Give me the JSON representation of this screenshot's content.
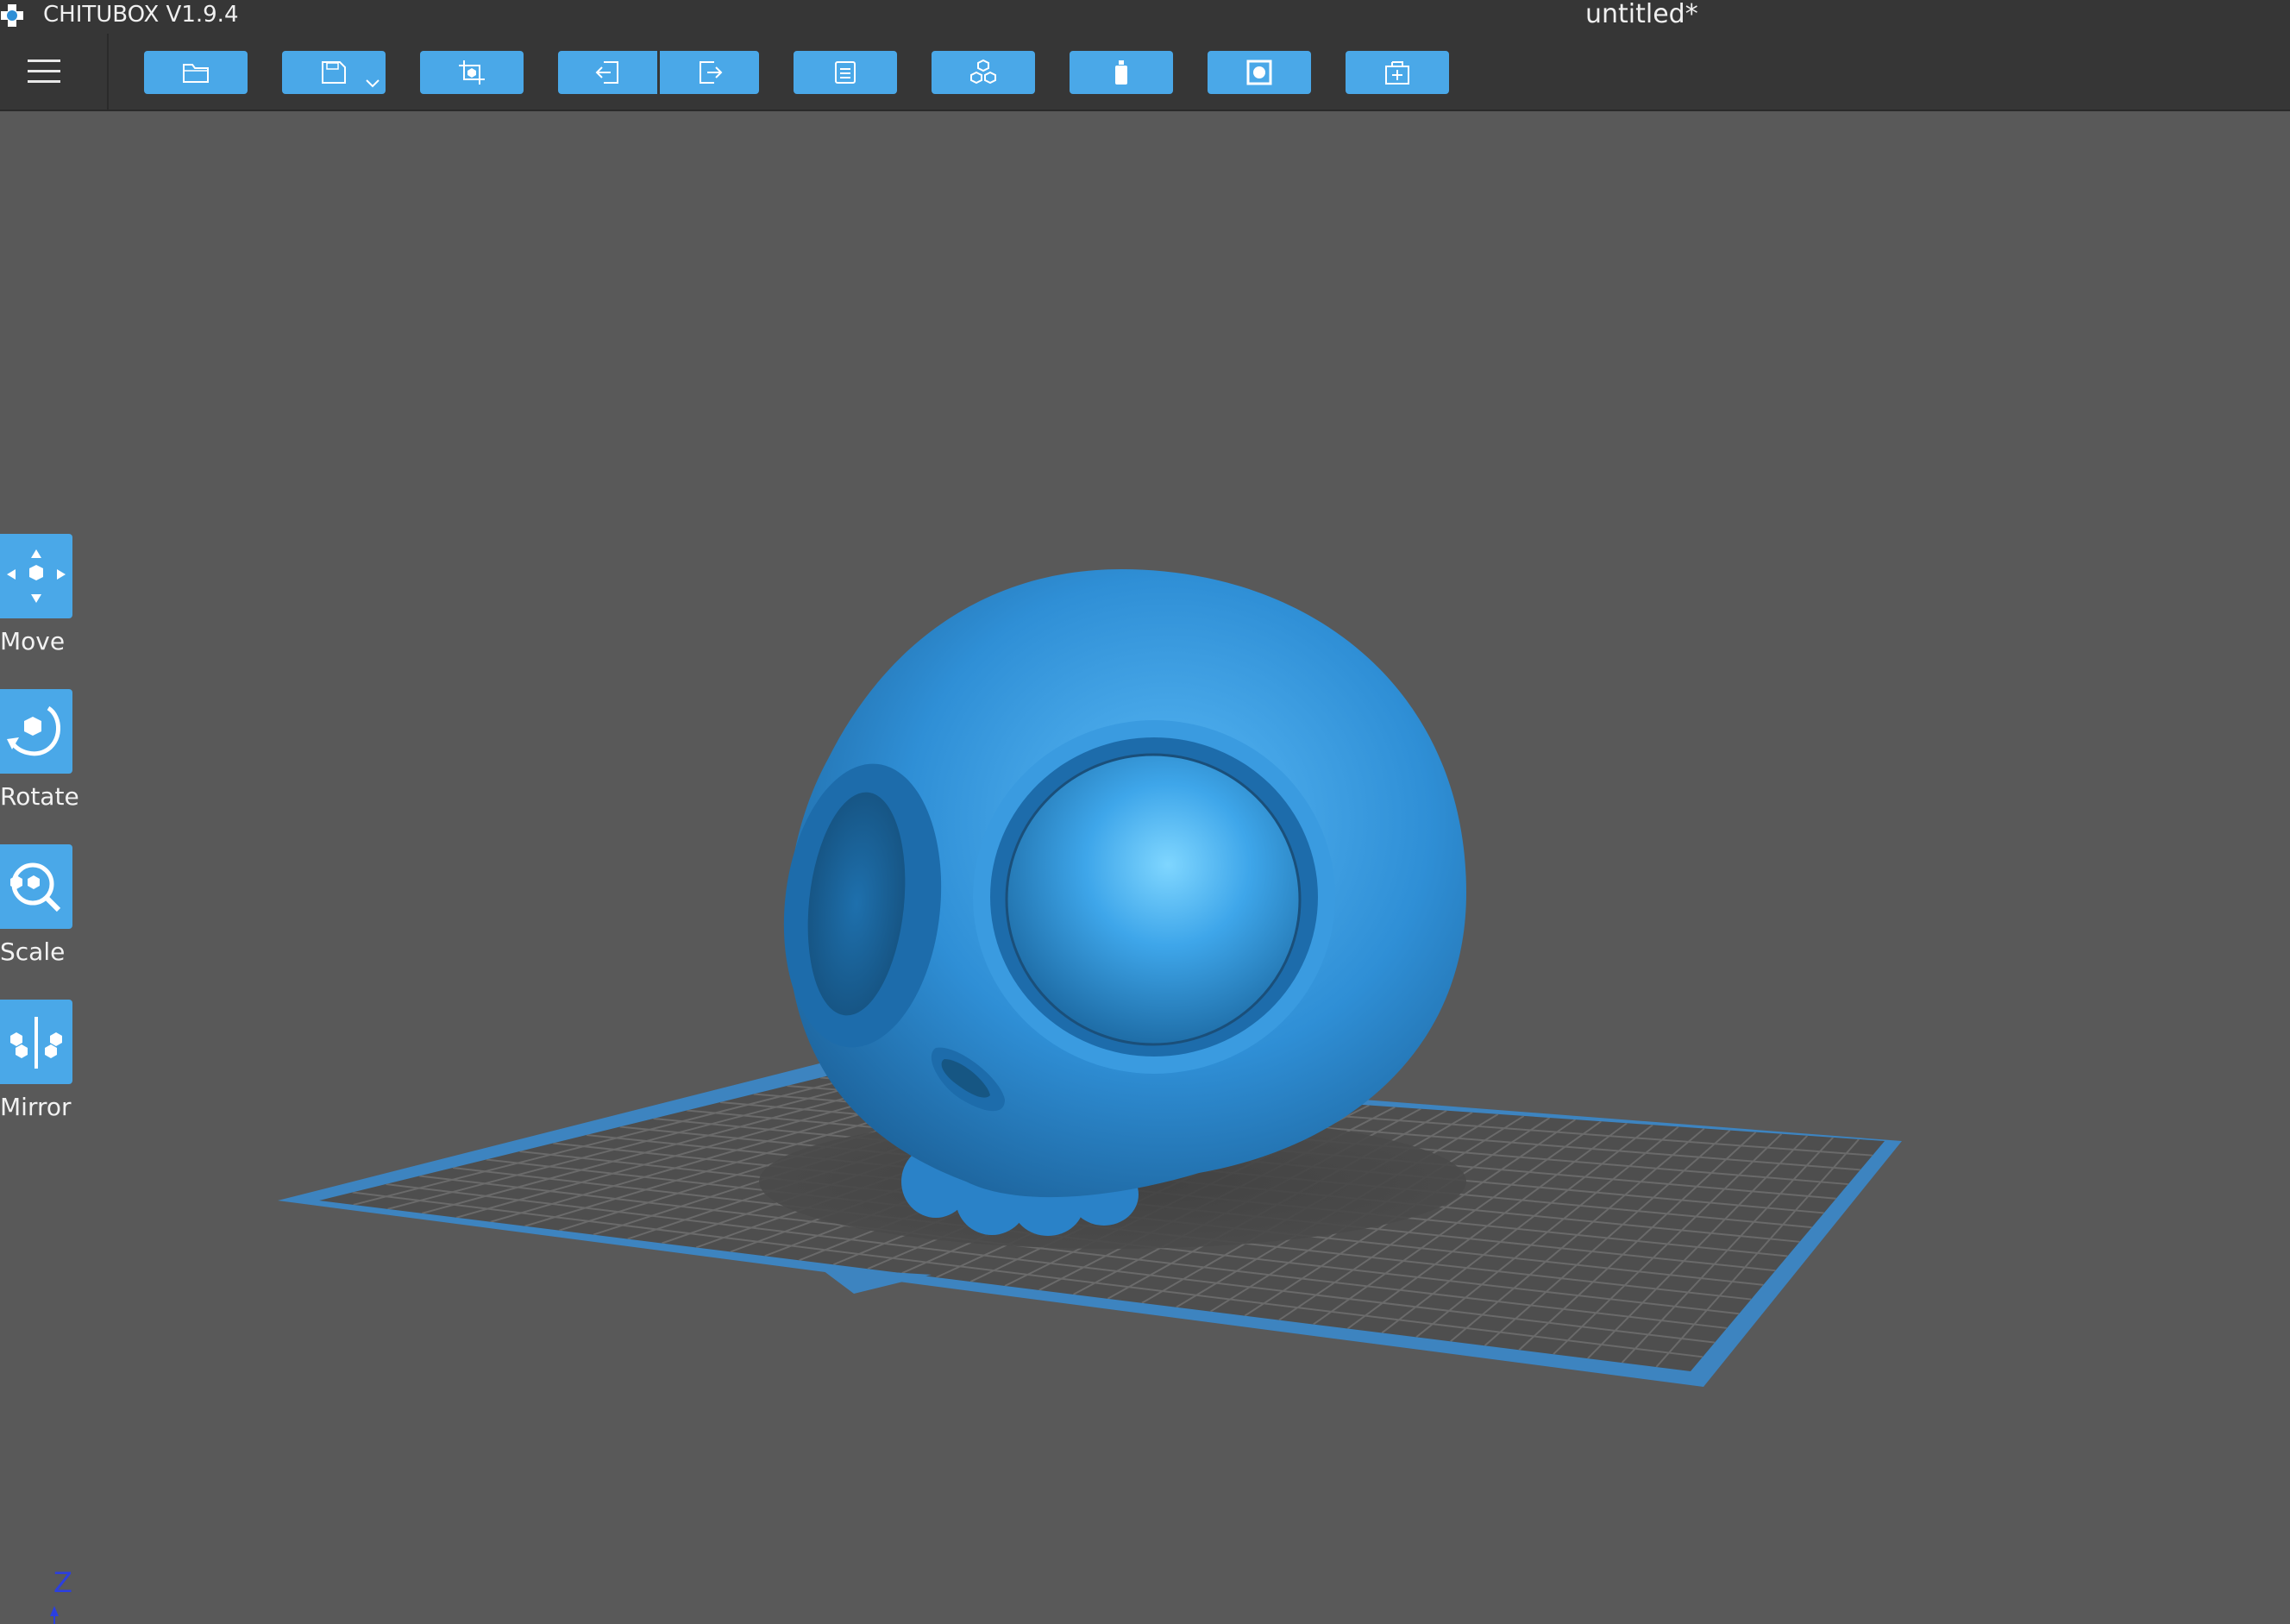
{
  "window": {
    "app_name": "CHITUBOX V1.9.4",
    "document_title": "untitled*"
  },
  "toolbar": {
    "buttons": [
      {
        "name": "open-file-button",
        "icon": "folder-icon"
      },
      {
        "name": "save-file-button",
        "icon": "floppy-disk-icon",
        "has_dropdown": true
      },
      {
        "name": "crop-view-button",
        "icon": "crop-box-icon"
      },
      {
        "name": "undo-button",
        "icon": "arrow-left-icon"
      },
      {
        "name": "redo-button",
        "icon": "arrow-right-icon"
      },
      {
        "name": "layers-button",
        "icon": "document-list-icon"
      },
      {
        "name": "arrange-button",
        "icon": "cubes-icon"
      },
      {
        "name": "supports-button",
        "icon": "bottle-icon"
      },
      {
        "name": "hollow-button",
        "icon": "square-dot-icon"
      },
      {
        "name": "add-model-button",
        "icon": "box-plus-icon"
      }
    ]
  },
  "side_tools": [
    {
      "label": "Move",
      "icon": "move-arrows-cube-icon"
    },
    {
      "label": "Rotate",
      "icon": "rotate-cube-icon"
    },
    {
      "label": "Scale",
      "icon": "scale-magnifier-icon"
    },
    {
      "label": "Mirror",
      "icon": "mirror-cubes-icon"
    }
  ],
  "axis": {
    "label": "Z"
  },
  "colors": {
    "accent": "#4aa8e8",
    "background": "#595959",
    "chrome": "#363636",
    "model": "#2f8fd6",
    "plate_border": "#3d84c0",
    "axis_z": "#2b3fe0"
  }
}
